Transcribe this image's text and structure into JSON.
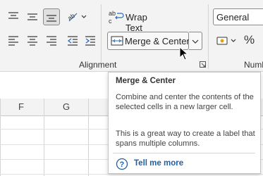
{
  "ribbon": {
    "wrap_text_label": "Wrap Text",
    "merge_center_label": "Merge & Center",
    "alignment_group_label": "Alignment",
    "number_group_label": "Numb",
    "number_format_value": "General",
    "percent_symbol": "%"
  },
  "grid": {
    "columns": [
      "F",
      "G"
    ]
  },
  "tooltip": {
    "title": "Merge & Center",
    "description": "Combine and center the contents of the selected cells in a new larger cell.",
    "detail": "This is a great way to create a label that spans multiple columns.",
    "link_label": "Tell me more"
  },
  "colors": {
    "ribbon_bg": "#f3f3f3",
    "link": "#1f5fa8",
    "accent_blue": "#1f5fa8"
  }
}
